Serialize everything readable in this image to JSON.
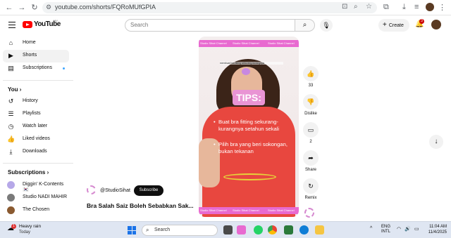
{
  "browser": {
    "url": "youtube.com/shorts/FQRoMUfGPIA",
    "back_icon": "arrow-left-icon",
    "forward_icon": "arrow-right-icon",
    "reload_icon": "reload-icon"
  },
  "header": {
    "logo_text": "YouTube",
    "logo_country": "MY",
    "search_placeholder": "Search",
    "create_label": "Create",
    "notif_count": "3"
  },
  "sidebar": {
    "main": [
      {
        "label": "Home",
        "icon": "home-icon"
      },
      {
        "label": "Shorts",
        "icon": "shorts-icon"
      },
      {
        "label": "Subscriptions",
        "icon": "subscriptions-icon"
      }
    ],
    "you_title": "You",
    "you": [
      {
        "label": "History",
        "icon": "history-icon"
      },
      {
        "label": "Playlists",
        "icon": "playlists-icon"
      },
      {
        "label": "Watch later",
        "icon": "watch-later-icon"
      },
      {
        "label": "Liked videos",
        "icon": "liked-videos-icon"
      },
      {
        "label": "Downloads",
        "icon": "downloads-icon"
      }
    ],
    "subs_title": "Subscriptions",
    "subs": [
      {
        "label": "Diggin' K-Contents 🇰🇷",
        "color": "#b6a8e8"
      },
      {
        "label": "Studio NADI MAHIR",
        "color": "#7a7a7a"
      },
      {
        "label": "The Chosen",
        "color": "#8a5a30"
      }
    ]
  },
  "short": {
    "brand_strip": "Studio Sihat Channel",
    "caption": "membuat bra fitting sekurang-kurangnya",
    "tips": "TIPS:",
    "bullet1": "Buat bra fitting sekurang-kurangnya setahun sekali",
    "bullet2": "Pilih bra yang beri sokongan, bukan tekanan",
    "channel": "@StudioSihat",
    "subscribe": "Subscribe",
    "title": "Bra Salah Saiz Boleh Sebabkan Sak..."
  },
  "actions": {
    "like_count": "33",
    "dislike_label": "Dislike",
    "comment_count": "2",
    "share_label": "Share",
    "remix_label": "Remix"
  },
  "taskbar": {
    "weather_title": "Heavy rain",
    "weather_sub": "Today",
    "weather_badge": "1",
    "search_placeholder": "Search",
    "lang1": "ENG",
    "lang2": "INTL",
    "time": "11:04 AM",
    "date": "11/4/2025"
  }
}
